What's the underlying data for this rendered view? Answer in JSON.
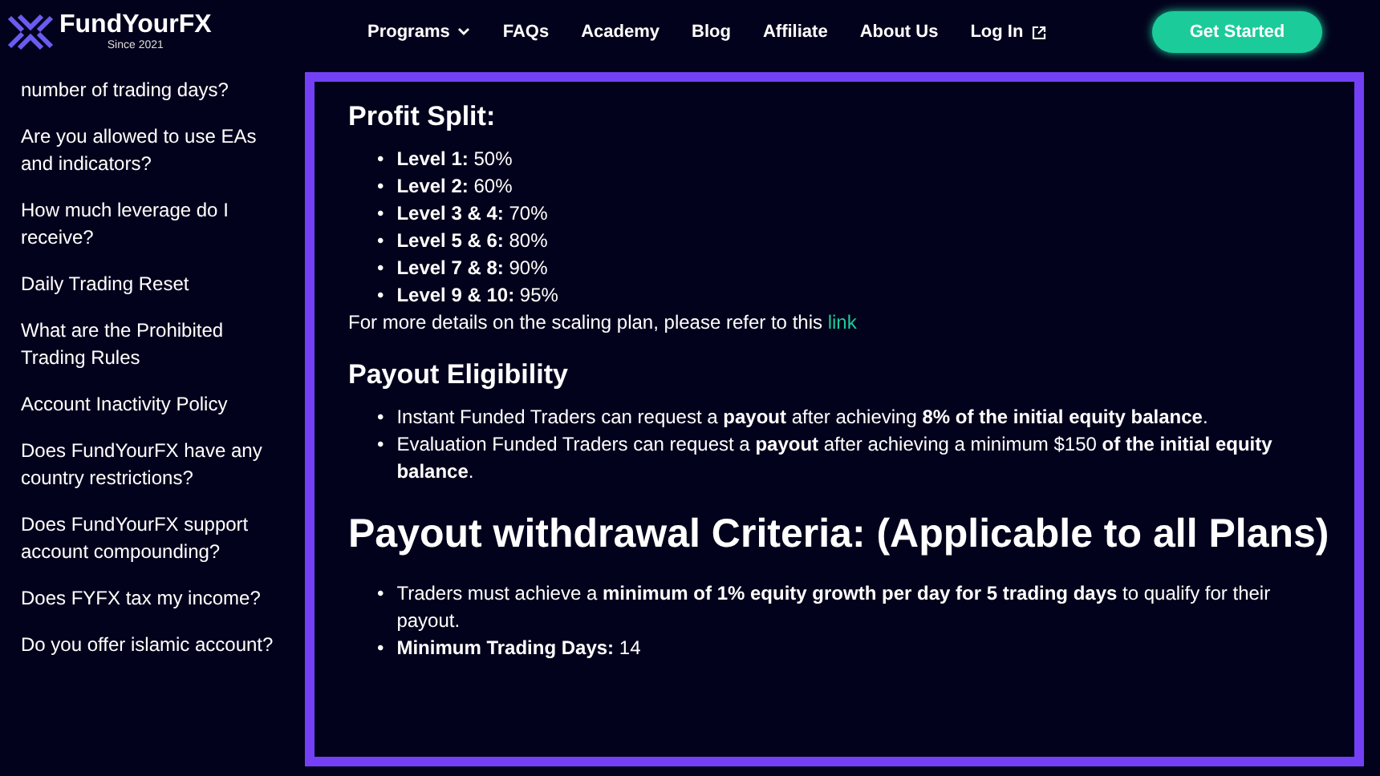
{
  "logo": {
    "name": "FundYourFX",
    "tagline": "Since 2021"
  },
  "nav": [
    {
      "label": "Programs",
      "dropdown": true,
      "external": false
    },
    {
      "label": "FAQs",
      "dropdown": false,
      "external": false
    },
    {
      "label": "Academy",
      "dropdown": false,
      "external": false
    },
    {
      "label": "Blog",
      "dropdown": false,
      "external": false
    },
    {
      "label": "Affiliate",
      "dropdown": false,
      "external": false
    },
    {
      "label": "About Us",
      "dropdown": false,
      "external": false
    },
    {
      "label": "Log In",
      "dropdown": false,
      "external": true
    }
  ],
  "cta": "Get Started",
  "sidebar": {
    "items": [
      "number of trading days?",
      "Are you allowed to use EAs and indicators?",
      "How much leverage do I receive?",
      "Daily Trading Reset",
      "What are the Prohibited Trading Rules",
      "Account Inactivity Policy",
      "Does FundYourFX have any country restrictions?",
      "Does FundYourFX support account compounding?",
      "Does FYFX tax my income?",
      "Do you offer islamic account?"
    ]
  },
  "content": {
    "marker": "•",
    "sections": [
      {
        "heading": "Profit Split:",
        "kind": "subheading",
        "bullets": [
          "**Level 1:** 50%",
          "**Level 2:** 60%",
          "**Level 3 & 4:** 70%",
          "**Level 5 & 6:** 80%",
          "**Level 7 & 8:** 90%",
          "**Level 9 & 10:** 95%"
        ],
        "note": {
          "text": "For more details on the scaling plan, please refer to this",
          "link": "link"
        }
      },
      {
        "heading": "Payout Eligibility",
        "kind": "subheading",
        "bullets": [
          "Instant Funded Traders can request a **payout** after achieving **8% of the initial equity balance**.",
          "Evaluation Funded Traders can request a **payout** after achieving a minimum $150 **of the initial equity balance**."
        ]
      },
      {
        "heading": "Payout withdrawal Criteria: (Applicable to all Plans)",
        "kind": "heading",
        "bullets": [
          "Traders must achieve a **minimum of 1% equity growth per day for 5 trading days** to qualify for their payout.",
          "**Minimum Trading Days:** 14"
        ]
      }
    ]
  }
}
